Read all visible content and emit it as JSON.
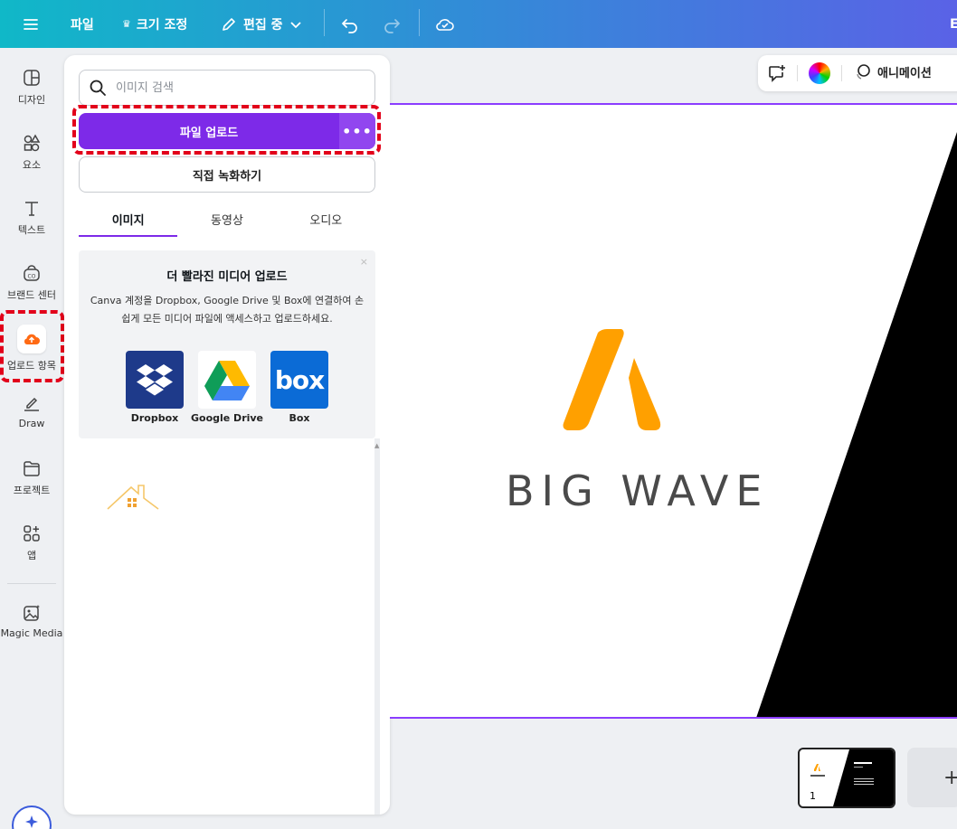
{
  "topbar": {
    "file_label": "파일",
    "resize_label": "크기 조정",
    "editing_label": "편집 중",
    "right_partial": "E"
  },
  "rail": {
    "items": [
      {
        "label": "디자인",
        "icon": "design-icon"
      },
      {
        "label": "요소",
        "icon": "elements-icon"
      },
      {
        "label": "텍스트",
        "icon": "text-icon"
      },
      {
        "label": "브랜드 센터",
        "icon": "brand-icon"
      },
      {
        "label": "업로드 항목",
        "icon": "upload-cloud-icon"
      },
      {
        "label": "Draw",
        "icon": "draw-icon"
      },
      {
        "label": "프로젝트",
        "icon": "folder-icon"
      },
      {
        "label": "앱",
        "icon": "apps-icon"
      },
      {
        "label": "Magic Media",
        "icon": "magic-media-icon"
      }
    ]
  },
  "panel": {
    "search_placeholder": "이미지 검색",
    "upload_label": "파일 업로드",
    "more_label": "•••",
    "record_label": "직접 녹화하기",
    "tabs": [
      {
        "label": "이미지",
        "active": true
      },
      {
        "label": "동영상",
        "active": false
      },
      {
        "label": "오디오",
        "active": false
      }
    ],
    "promo": {
      "title": "더 빨라진 미디어 업로드",
      "description": "Canva 계정을 Dropbox, Google Drive 및 Box에 연결하여 손쉽게 모든 미디어 파일에 액세스하고 업로드하세요.",
      "close": "×",
      "services": [
        {
          "label": "Dropbox",
          "icon": "dropbox-icon"
        },
        {
          "label": "Google Drive",
          "icon": "google-drive-icon"
        },
        {
          "label": "Box",
          "icon": "box-icon"
        }
      ],
      "box_logo_text": "box"
    }
  },
  "context_bar": {
    "animation_label": "애니메이션"
  },
  "canvas": {
    "brand_name": "BIG WAVE",
    "page_number": "1"
  },
  "colors": {
    "accent": "#7d2ae8",
    "brand_orange": "#ffa000",
    "highlight": "#e2001a"
  }
}
